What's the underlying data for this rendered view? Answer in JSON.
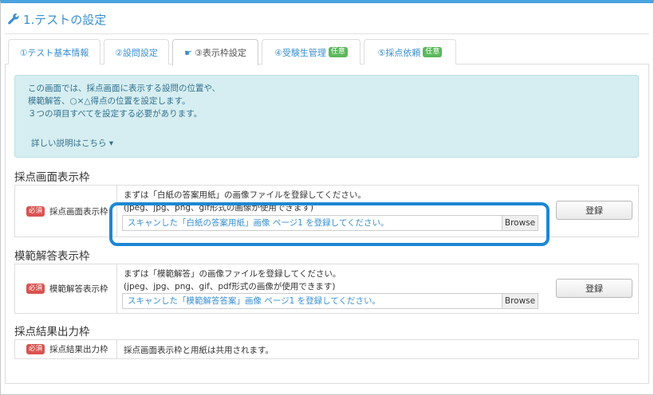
{
  "page": {
    "title": "1.テストの設定"
  },
  "tabs": [
    {
      "label": "①テスト基本情報",
      "badge": ""
    },
    {
      "label": "②設問設定",
      "badge": ""
    },
    {
      "label": "③表示枠設定",
      "badge": ""
    },
    {
      "label": "④受験生管理",
      "badge": "任意"
    },
    {
      "label": "⑤採点依頼",
      "badge": "任意"
    }
  ],
  "info": {
    "lines": [
      "この画面では、採点画面に表示する設問の位置や、",
      "模範解答、○×△得点の位置を設定します。",
      "３つの項目すべてを設定する必要があります。"
    ],
    "more_label": "詳しい説明はこちら ▾"
  },
  "sections": {
    "scoring_frame": {
      "title": "採点画面表示枠",
      "required": "必須",
      "label": "採点画面表示枠",
      "desc1": "まずは「白紙の答案用紙」の画像ファイルを登録してください。",
      "desc2": "(jpeg、jpg、png、gif形式の画像が使用できます)",
      "file_placeholder": "スキャンした「白紙の答案用紙」画像 ページ1 を登録してください。",
      "browse_label": "Browse",
      "register_label": "登録"
    },
    "answer_frame": {
      "title": "模範解答表示枠",
      "required": "必須",
      "label": "模範解答表示枠",
      "desc1": "まずは「模範解答」の画像ファイルを登録してください。",
      "desc2": "(jpeg、jpg、png、gif、pdf形式の画像が使用できます)",
      "file_placeholder": "スキャンした「模範解答答案」画像 ページ1 を登録してください。",
      "browse_label": "Browse",
      "register_label": "登録"
    },
    "result_frame": {
      "title": "採点結果出力枠",
      "required": "必須",
      "label": "採点結果出力枠",
      "note": "採点画面表示枠と用紙は共用されます。"
    }
  },
  "colors": {
    "accent": "#3a8fd0",
    "highlight": "#1e87d4",
    "info_bg": "#d6eef1",
    "required": "#d9534f",
    "optional": "#5cb85c"
  }
}
